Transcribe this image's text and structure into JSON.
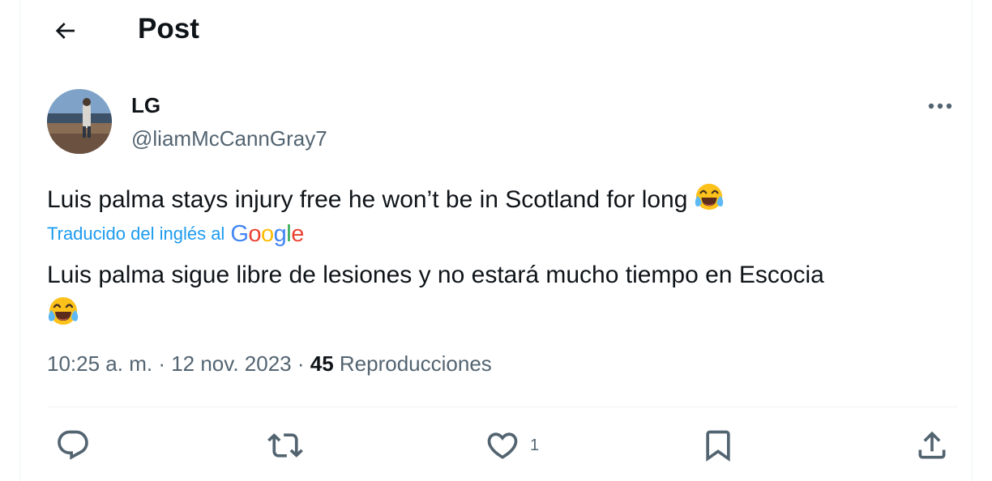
{
  "header": {
    "title": "Post",
    "back_icon": "arrow-left-icon"
  },
  "tweet": {
    "author_name": "LG",
    "author_handle": "@liamMcCannGray7",
    "text": "Luis palma stays injury free he  won’t be in Scotland for long",
    "translation_label": "Traducido del inglés al",
    "translation_provider": "Google",
    "translated_text": "Luis palma sigue libre de lesiones y no estará mucho tiempo en Escocia",
    "emoji": "face-with-tears-of-joy",
    "time": "10:25 a. m.",
    "date": "12 nov. 2023",
    "views_count": "45",
    "views_label": "Reproducciones"
  },
  "actions": {
    "reply_icon": "reply-icon",
    "retweet_icon": "retweet-icon",
    "like_icon": "heart-icon",
    "like_count": "1",
    "bookmark_icon": "bookmark-icon",
    "share_icon": "share-icon"
  },
  "colors": {
    "link": "#1d9bf0",
    "secondary": "#536471",
    "text": "#0f1419"
  }
}
